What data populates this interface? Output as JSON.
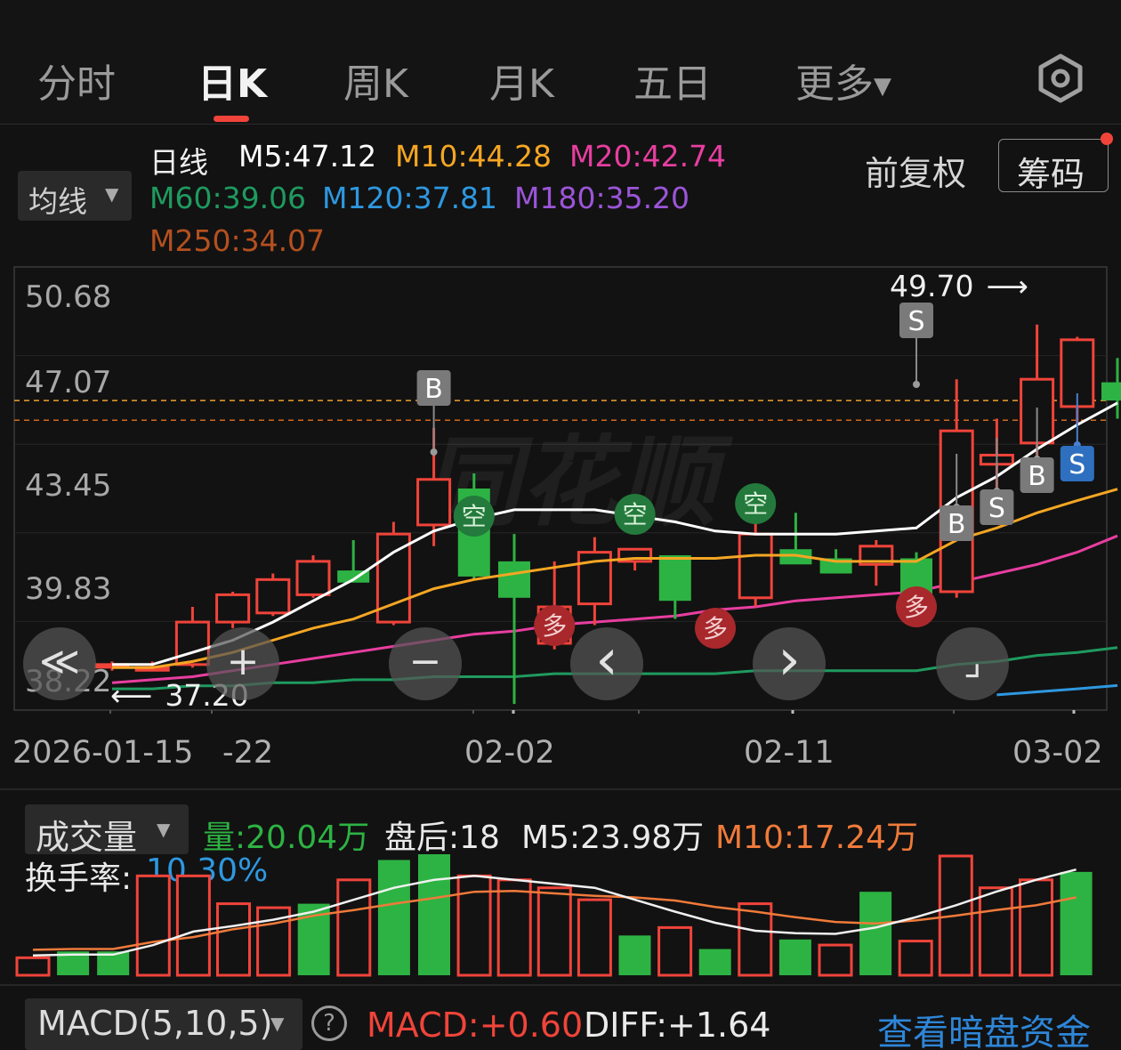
{
  "tabs": [
    {
      "label": "分时",
      "active": false
    },
    {
      "label": "日K",
      "active": true
    },
    {
      "label": "周K",
      "active": false
    },
    {
      "label": "月K",
      "active": false
    },
    {
      "label": "五日",
      "active": false
    },
    {
      "label": "更多",
      "active": false,
      "dropdown": true
    }
  ],
  "settings_icon": "hexagon-settings-icon",
  "indicator": {
    "ma_selector": "均线",
    "period_label": "日线",
    "ma_values": [
      {
        "label": "M5:47.12",
        "color": "#ffffff"
      },
      {
        "label": "M10:44.28",
        "color": "#f5a623"
      },
      {
        "label": "M20:42.74",
        "color": "#e83ea0"
      },
      {
        "label": "M60:39.06",
        "color": "#1f9a5f"
      },
      {
        "label": "M120:37.81",
        "color": "#2e98e0"
      },
      {
        "label": "M180:35.20",
        "color": "#9b55d8"
      },
      {
        "label": "M250:34.07",
        "color": "#b4501f"
      }
    ],
    "adjust_label": "前复权",
    "chips_button": "筹码"
  },
  "price_axis": [
    "50.68",
    "47.07",
    "43.45",
    "39.83",
    "38.22"
  ],
  "high_marker": "49.70",
  "low_marker": "37.20",
  "dates": [
    "2026-01-15",
    "-22",
    "02-02",
    "02-11",
    "03-02"
  ],
  "signals": {
    "buy": "B",
    "sell": "S",
    "empty": "空",
    "long": "多"
  },
  "watermark": "同花顺",
  "controls": [
    {
      "name": "rewind-icon",
      "glyph": "≪"
    },
    {
      "name": "zoom-in-icon",
      "glyph": "+"
    },
    {
      "name": "zoom-out-icon",
      "glyph": "−"
    },
    {
      "name": "prev-icon",
      "glyph": "‹"
    },
    {
      "name": "next-icon",
      "glyph": "›"
    },
    {
      "name": "fullscreen-icon",
      "glyph": "⌟"
    }
  ],
  "volume": {
    "selector": "成交量",
    "vol_label": "量:20.04万",
    "after_hours": "盘后:18",
    "m5": "M5:23.98万",
    "m10": "M10:17.24万",
    "turnover_label": "换手率:",
    "turnover_value": "10.30%"
  },
  "macd": {
    "selector": "MACD(5,10,5)",
    "help_icon": "?",
    "macd_value": "MACD:+0.60",
    "diff_value": "DIFF:+1.64",
    "dark_pool_link": "查看暗盘资金"
  },
  "colors": {
    "up": "#f0443a",
    "down": "#2db343",
    "bg": "#121212"
  },
  "chart_data": {
    "type": "candlestick",
    "series": [
      {
        "name": "K",
        "ohlc": [
          [
            38.5,
            38.6,
            38.3,
            38.5
          ],
          [
            38.4,
            38.6,
            38.3,
            38.4
          ],
          [
            38.5,
            40.4,
            38.4,
            39.9
          ],
          [
            39.9,
            40.9,
            39.7,
            40.8
          ],
          [
            40.2,
            41.5,
            40.1,
            41.3
          ],
          [
            40.8,
            42.1,
            40.7,
            41.9
          ],
          [
            41.6,
            42.6,
            41.3,
            41.2
          ],
          [
            39.9,
            43.2,
            39.8,
            42.8
          ],
          [
            43.1,
            46.3,
            42.4,
            44.6
          ],
          [
            44.3,
            44.8,
            41.3,
            41.4
          ],
          [
            41.9,
            42.8,
            37.2,
            40.7
          ],
          [
            39.2,
            41.9,
            39.0,
            40.4
          ],
          [
            40.5,
            42.7,
            39.8,
            42.2
          ],
          [
            41.9,
            42.3,
            41.6,
            42.3
          ],
          [
            42.1,
            42.1,
            40.0,
            40.6
          ],
          [
            39.6,
            40.1,
            39.1,
            39.5
          ],
          [
            40.7,
            43.3,
            40.4,
            42.8
          ],
          [
            42.3,
            43.5,
            41.9,
            41.8
          ],
          [
            42.0,
            42.3,
            41.5,
            41.5
          ],
          [
            41.8,
            42.6,
            41.1,
            42.4
          ],
          [
            42.0,
            42.2,
            40.5,
            40.7
          ],
          [
            40.9,
            47.9,
            40.7,
            46.2
          ],
          [
            45.1,
            46.6,
            44.0,
            45.4
          ],
          [
            45.8,
            49.7,
            44.8,
            47.9
          ],
          [
            47.0,
            49.3,
            46.4,
            49.2
          ],
          [
            47.8,
            48.6,
            46.6,
            47.2
          ]
        ]
      },
      {
        "name": "M5",
        "values": [
          38.5,
          38.5,
          38.9,
          39.3,
          39.9,
          40.6,
          41.3,
          42.2,
          42.9,
          43.3,
          43.6,
          43.6,
          43.6,
          43.4,
          43.2,
          42.9,
          42.8,
          42.8,
          42.8,
          42.9,
          43.0,
          44.0,
          44.7,
          45.6,
          46.4,
          47.12
        ]
      },
      {
        "name": "M10",
        "values": [
          38.4,
          38.4,
          38.6,
          38.9,
          39.3,
          39.7,
          40.0,
          40.5,
          41.0,
          41.3,
          41.5,
          41.7,
          41.9,
          42.0,
          42.0,
          42.0,
          42.1,
          42.1,
          41.9,
          41.9,
          41.9,
          42.6,
          43.0,
          43.5,
          43.9,
          44.28
        ]
      },
      {
        "name": "M20",
        "values": [
          37.9,
          38.0,
          38.1,
          38.3,
          38.5,
          38.7,
          38.9,
          39.1,
          39.3,
          39.5,
          39.6,
          39.8,
          39.9,
          40.0,
          40.1,
          40.3,
          40.4,
          40.6,
          40.7,
          40.8,
          40.9,
          41.2,
          41.5,
          41.8,
          42.2,
          42.74
        ]
      },
      {
        "name": "M60",
        "values": [
          37.7,
          37.7,
          37.8,
          37.8,
          37.9,
          37.9,
          38.0,
          38.0,
          38.1,
          38.1,
          38.1,
          38.2,
          38.2,
          38.2,
          38.2,
          38.2,
          38.3,
          38.3,
          38.3,
          38.3,
          38.3,
          38.5,
          38.6,
          38.8,
          38.9,
          39.06
        ]
      },
      {
        "name": "M120",
        "values": [
          null,
          null,
          null,
          null,
          null,
          null,
          null,
          null,
          null,
          null,
          null,
          null,
          null,
          null,
          null,
          null,
          null,
          null,
          null,
          null,
          null,
          null,
          37.5,
          37.6,
          37.7,
          37.81
        ]
      }
    ],
    "dates": [
      "2026-01-15",
      "-22",
      "02-02",
      "02-11",
      "03-02"
    ],
    "ylim": [
      37.0,
      51.6
    ],
    "volume": [
      2.2,
      3.0,
      3.0,
      12.5,
      12.5,
      9.0,
      8.5,
      9.0,
      12.0,
      14.5,
      16.5,
      12.5,
      12.0,
      11.0,
      9.5,
      5.0,
      6.0,
      3.3,
      9.0,
      4.5,
      3.8,
      10.5,
      4.3,
      15.0,
      11.0,
      12.0,
      13.0,
      10.0
    ]
  }
}
